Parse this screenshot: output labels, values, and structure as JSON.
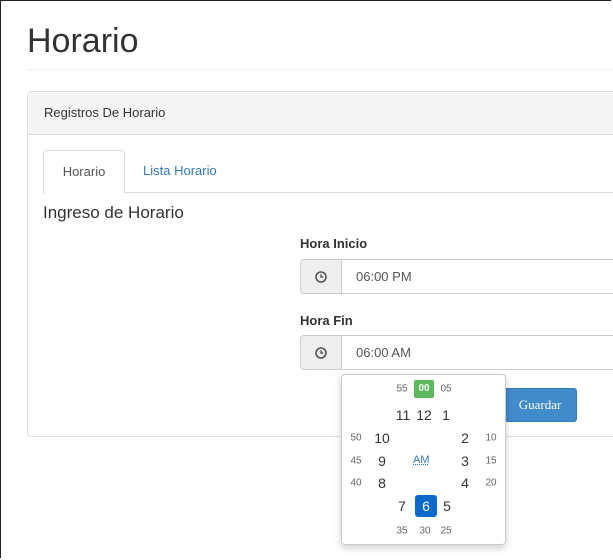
{
  "page": {
    "title": "Horario"
  },
  "panel": {
    "heading": "Registros De Horario"
  },
  "tabs": [
    {
      "label": "Horario",
      "active": true
    },
    {
      "label": "Lista Horario",
      "active": false
    }
  ],
  "form": {
    "section_title": "Ingreso de Horario",
    "start": {
      "label": "Hora Inicio",
      "value": "06:00 PM",
      "icon": "clock-icon"
    },
    "end": {
      "label": "Hora Fin",
      "value": "06:00 AM",
      "icon": "clock-icon"
    },
    "save_label": "Guardar"
  },
  "clockpicker": {
    "selected_minute": "00",
    "selected_hour": "6",
    "ampm": "AM",
    "minutes": {
      "m55": "55",
      "m05": "05",
      "m50": "50",
      "m10": "10",
      "m45": "45",
      "m15": "15",
      "m40": "40",
      "m20": "20",
      "m35": "35",
      "m30": "30",
      "m25": "25"
    },
    "hours": {
      "h11": "11",
      "h12": "12",
      "h1": "1",
      "h10": "10",
      "h2": "2",
      "h9": "9",
      "h3": "3",
      "h8": "8",
      "h4": "4",
      "h7": "7",
      "h5": "5"
    }
  },
  "colors": {
    "primary": "#428bca",
    "link": "#337ab7",
    "selected_minute": "#5cb85c",
    "selected_hour": "#0a6bcb"
  }
}
